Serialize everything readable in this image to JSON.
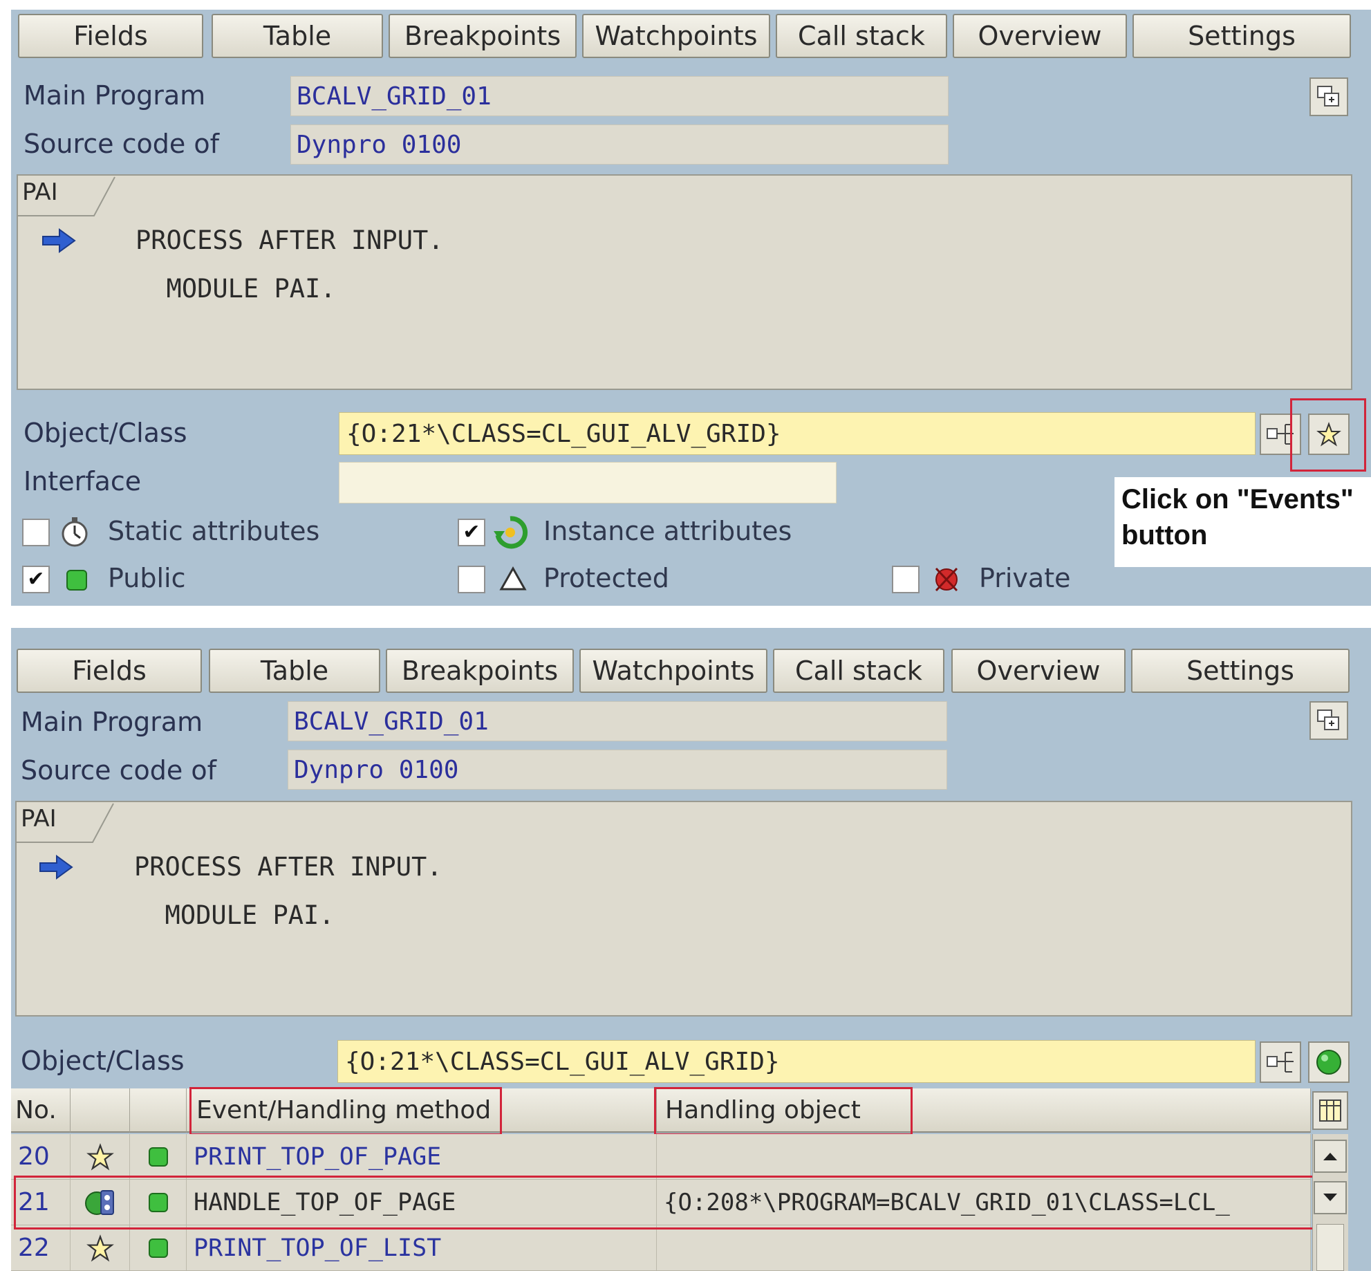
{
  "tabs": [
    "Fields",
    "Table",
    "Breakpoints",
    "Watchpoints",
    "Call stack",
    "Overview",
    "Settings"
  ],
  "main_program": {
    "label": "Main Program",
    "value": "BCALV_GRID_01"
  },
  "source_code": {
    "label": "Source code of",
    "value": "Dynpro 0100"
  },
  "code_editor": {
    "tab": "PAI",
    "lines": [
      "PROCESS AFTER INPUT.",
      "  MODULE PAI."
    ]
  },
  "object_class": {
    "label": "Object/Class",
    "value": "{O:21*\\CLASS=CL_GUI_ALV_GRID}"
  },
  "interface": {
    "label": "Interface",
    "value": ""
  },
  "checkboxes": {
    "static_attributes": {
      "label": "Static attributes",
      "checked": false,
      "icon": "stopwatch-icon"
    },
    "instance_attributes": {
      "label": "Instance attributes",
      "checked": true,
      "icon": "green-recycle-icon"
    },
    "public": {
      "label": "Public",
      "checked": true,
      "icon": "green-square-icon"
    },
    "protected": {
      "label": "Protected",
      "checked": false,
      "icon": "triangle-icon"
    },
    "private": {
      "label": "Private",
      "checked": false,
      "icon": "red-x-ball-icon"
    }
  },
  "callout": {
    "line1": "Click on \"Events\"",
    "line2": "button"
  },
  "events_table": {
    "headers": {
      "no": "No.",
      "event": "Event/Handling method",
      "object": "Handling object"
    },
    "rows": [
      {
        "no": "20",
        "icon": "star-icon",
        "visibility": "public",
        "event": "PRINT_TOP_OF_PAGE",
        "object": "",
        "highlighted": false
      },
      {
        "no": "21",
        "icon": "handler-method-icon",
        "visibility": "public",
        "event": "HANDLE_TOP_OF_PAGE",
        "object": "{O:208*\\PROGRAM=BCALV_GRID_01\\CLASS=LCL_",
        "highlighted": true
      },
      {
        "no": "22",
        "icon": "star-icon",
        "visibility": "public",
        "event": "PRINT_TOP_OF_LIST",
        "object": "",
        "highlighted": false
      }
    ]
  },
  "colors": {
    "panel_bg": "#aec2d2",
    "value_text": "#2b34a0",
    "object_input_bg": "#fdf3b1",
    "highlight_border": "#d2243a"
  }
}
